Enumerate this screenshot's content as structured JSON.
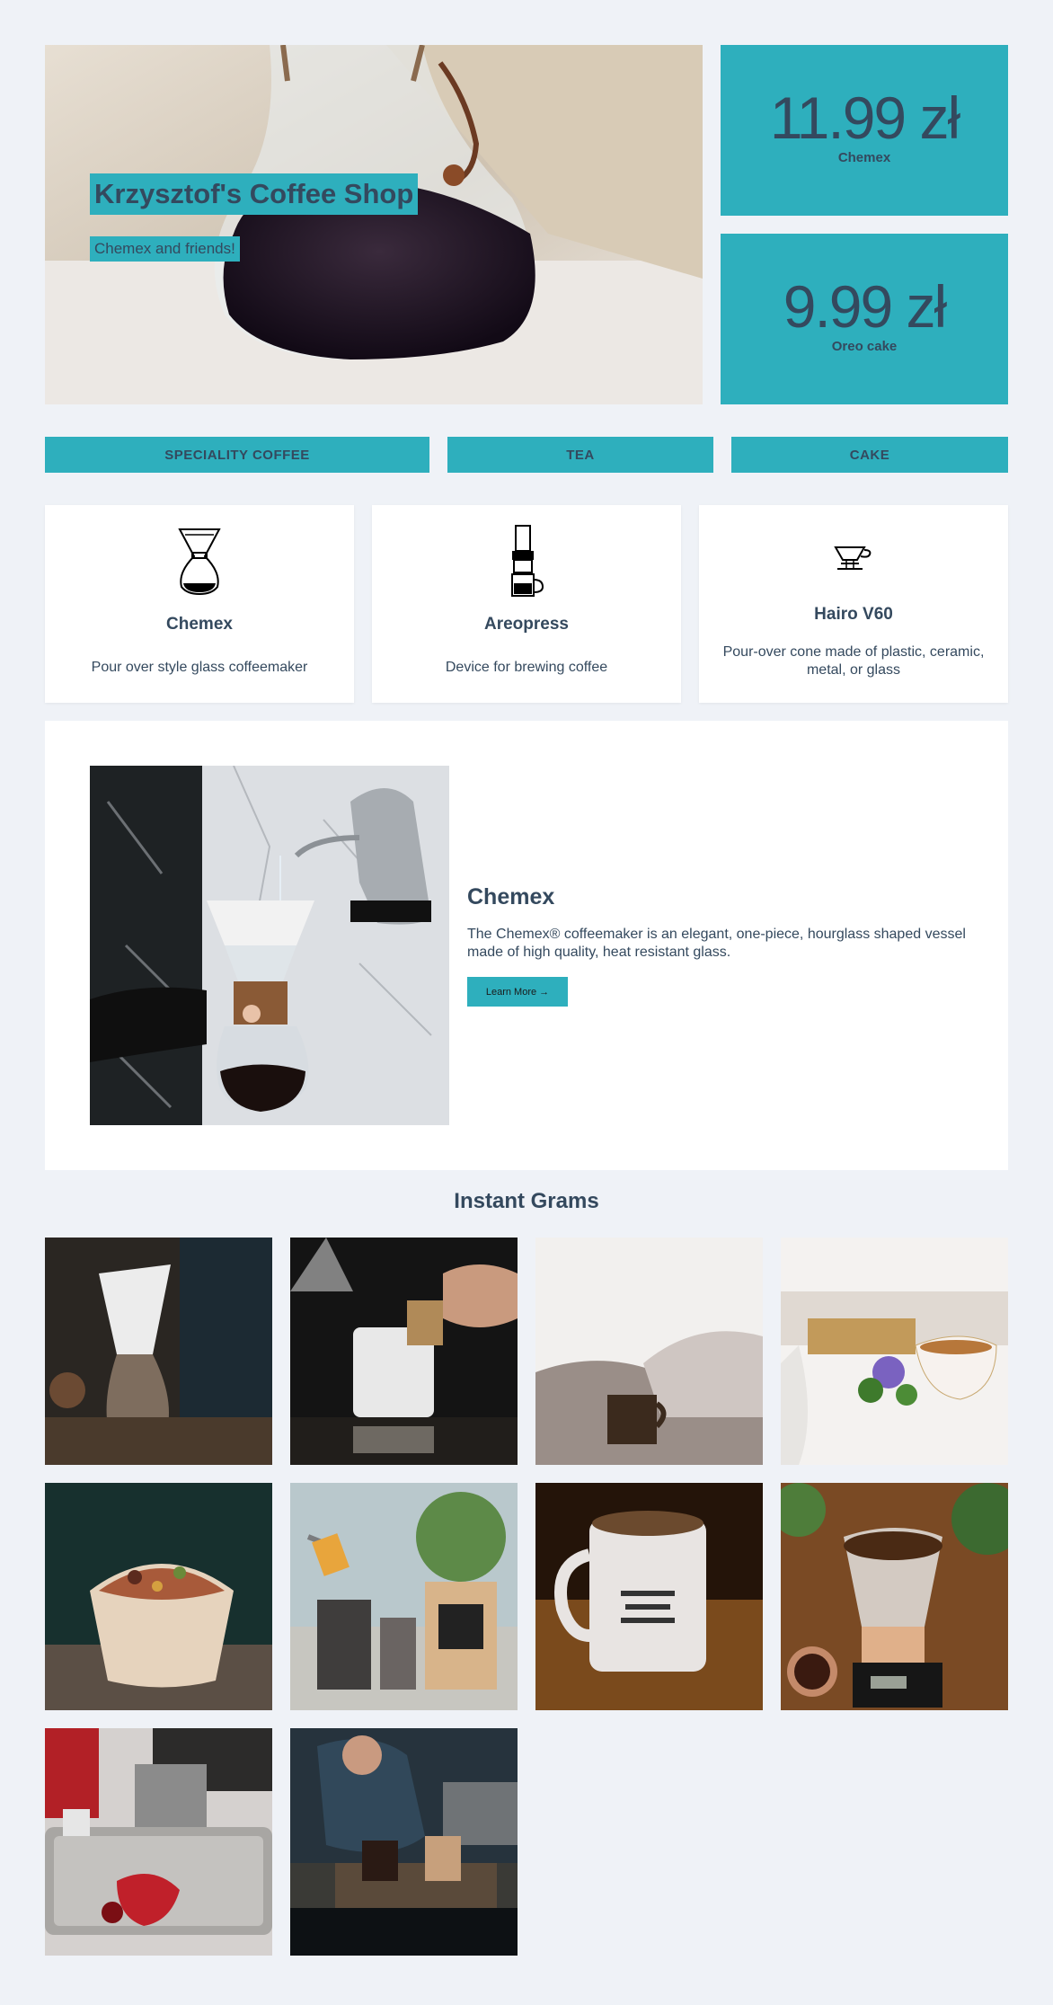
{
  "hero": {
    "title": "Krzysztof's Coffee Shop",
    "subtitle": "Chemex and friends!"
  },
  "prices": [
    {
      "price": "11.99 zł",
      "name": "Chemex"
    },
    {
      "price": "9.99 zł",
      "name": "Oreo cake"
    }
  ],
  "categories": [
    "SPECIALITY COFFEE",
    "TEA",
    "CAKE"
  ],
  "cards": [
    {
      "title": "Chemex",
      "description": "Pour over style glass coffeemaker",
      "icon": "chemex-icon"
    },
    {
      "title": "Areopress",
      "description": "Device for brewing coffee",
      "icon": "aeropress-icon"
    },
    {
      "title": "Hairo V60",
      "description": "Pour-over cone made of plastic, ceramic, metal, or glass",
      "icon": "v60-icon"
    }
  ],
  "feature": {
    "title": "Chemex",
    "text": "The Chemex® coffeemaker is an elegant, one-piece, hourglass shaped vessel made of high quality, heat resistant glass.",
    "button": "Learn More →"
  },
  "grams": {
    "title": "Instant Grams"
  },
  "colors": {
    "accent": "#2eafbd",
    "text": "#34495e",
    "background": "#eff2f7"
  }
}
